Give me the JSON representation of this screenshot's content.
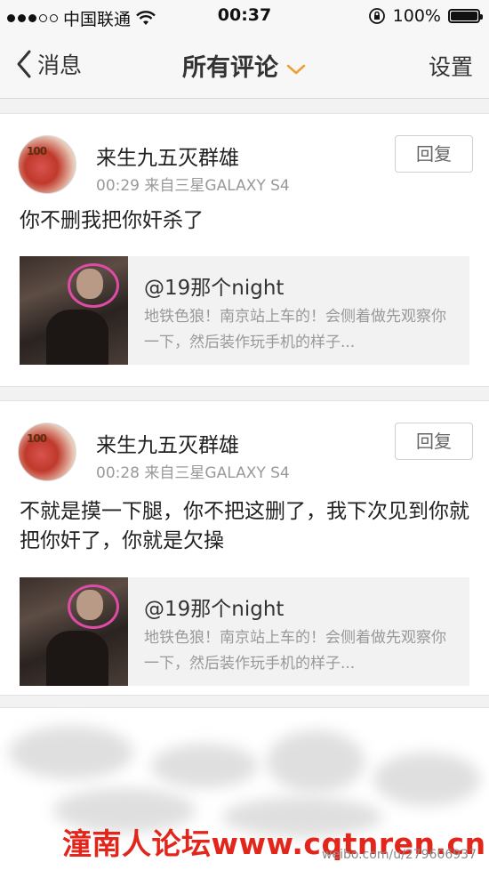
{
  "status_bar": {
    "carrier": "中国联通",
    "time": "00:37",
    "battery": "100%",
    "battery_level": 1.0
  },
  "nav": {
    "back_label": "消息",
    "title": "所有评论",
    "settings_label": "设置"
  },
  "comments": [
    {
      "username": "来生九五灭群雄",
      "time": "00:29",
      "source": "来自三星GALAXY S4",
      "reply_label": "回复",
      "text": "你不删我把你奸杀了",
      "quote": {
        "author": "@19那个night",
        "text": "地铁色狼！南京站上车的！会侧着做先观察你一下，然后装作玩手机的样子..."
      }
    },
    {
      "username": "来生九五灭群雄",
      "time": "00:28",
      "source": "来自三星GALAXY S4",
      "reply_label": "回复",
      "text": "不就是摸一下腿，你不把这删了，我下次见到你就把你奸了，你就是欠操",
      "quote": {
        "author": "@19那个night",
        "text": "地铁色狼！南京站上车的！会侧着做先观察你一下，然后装作玩手机的样子..."
      }
    }
  ],
  "watermark": {
    "site": "潼南人论坛www.cqtnren.cn",
    "weibo_url": "weibo.com/u/279606937"
  },
  "colors": {
    "accent_orange": "#f0a030",
    "watermark_red": "#e2261c",
    "avatar_ring": "#e04ba8"
  }
}
